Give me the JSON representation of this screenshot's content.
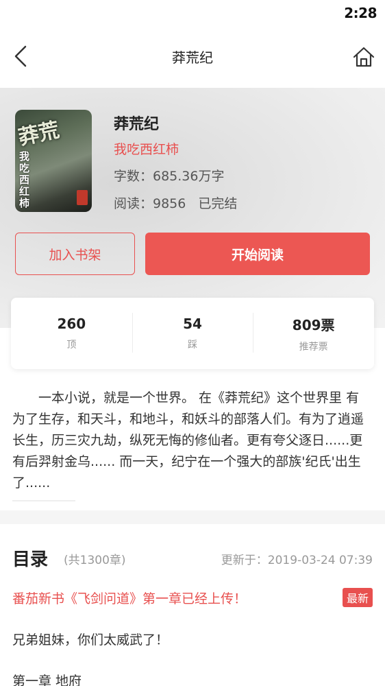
{
  "status_bar": {
    "time": "2:28"
  },
  "nav": {
    "title": "莽荒纪"
  },
  "book": {
    "name": "莽荒纪",
    "author": "我吃西红柿",
    "words": "字数：685.36万字",
    "reads": "阅读：9856",
    "status": "已完结",
    "cover_text": "我吃西红柿",
    "cover_art_title": "莽荒"
  },
  "actions": {
    "add_shelf": "加入书架",
    "start_reading": "开始阅读"
  },
  "stats": [
    {
      "value": "260",
      "label": "顶"
    },
    {
      "value": "54",
      "label": "踩"
    },
    {
      "value": "809票",
      "label": "推荐票"
    }
  ],
  "intro": "　　一本小说，就是一个世界。 在《莽荒纪》这个世界里 有为了生存，和天斗，和地斗，和妖斗的部落人们。有为了逍遥长生，历三灾九劫，纵死无悔的修仙者。更有夸父逐日......更有后羿射金乌...... 而一天，纪宁在一个强大的部族'纪氏'出生了......",
  "toc": {
    "title": "目录",
    "count": "(共1300章)",
    "updated": "更新于：2019-03-24 07:39",
    "chapters": [
      {
        "title": "番茄新书《飞剑问道》第一章已经上传！",
        "badge": "最新"
      },
      {
        "title": "兄弟姐妹，你们太威武了！"
      },
      {
        "title": "第一章 地府"
      }
    ]
  },
  "colors": {
    "accent": "#ec5753",
    "author": "#e8504f"
  }
}
